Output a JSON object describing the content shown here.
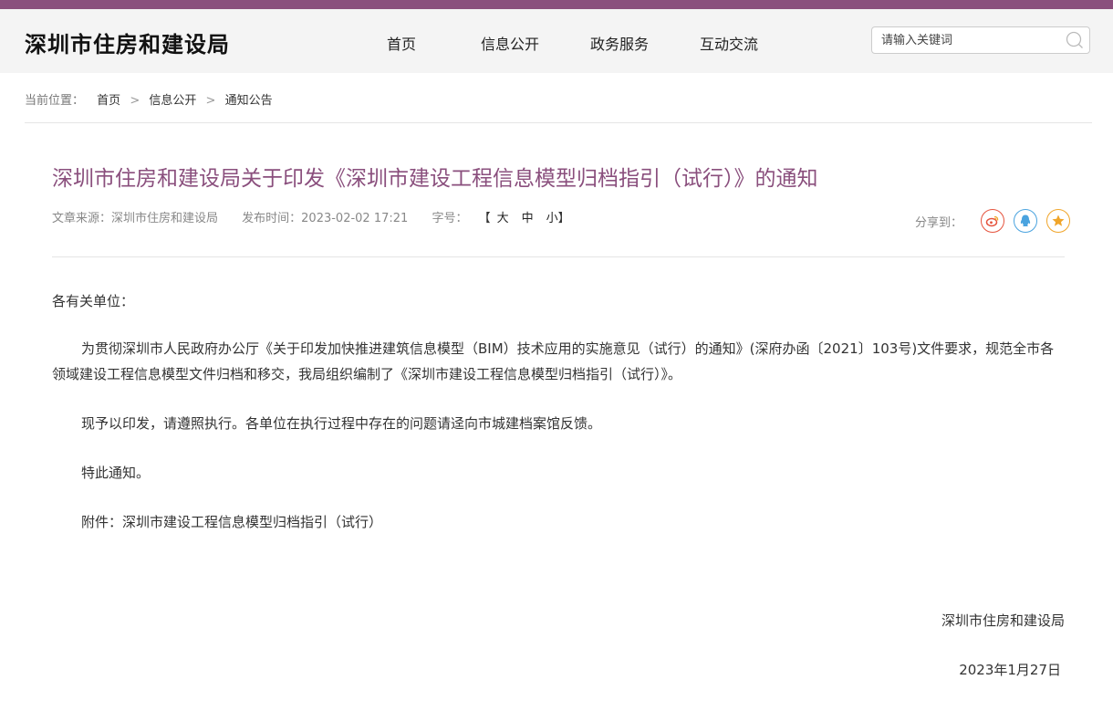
{
  "site": {
    "title": "深圳市住房和建设局"
  },
  "nav": {
    "items": [
      "首页",
      "信息公开",
      "政务服务",
      "互动交流"
    ]
  },
  "search": {
    "placeholder": "请输入关键词"
  },
  "breadcrumb": {
    "label": "当前位置：",
    "items": [
      "首页",
      "信息公开",
      "通知公告"
    ],
    "separator": ">"
  },
  "article": {
    "title": "深圳市住房和建设局关于印发《深圳市建设工程信息模型归档指引（试行）》的通知",
    "source": "文章来源：深圳市住房和建设局",
    "published": "发布时间：2023-02-02 17:21",
    "font_size_label": "字号：",
    "font_size_open": "【",
    "font_size_close": "】",
    "font_sizes": [
      "大",
      "中",
      "小"
    ],
    "share_label": "分享到：",
    "share_icons": [
      "weibo-icon",
      "qq-icon",
      "favorite-icon"
    ],
    "greeting": "各有关单位：",
    "paragraphs": [
      "为贯彻深圳市人民政府办公厅《关于印发加快推进建筑信息模型（BIM）技术应用的实施意见（试行）的通知》(深府办函〔2021〕103号)文件要求，规范全市各领域建设工程信息模型文件归档和移交，我局组织编制了《深圳市建设工程信息模型归档指引（试行）》。",
      "现予以印发，请遵照执行。各单位在执行过程中存在的问题请迳向市城建档案馆反馈。",
      "特此通知。",
      "附件：深圳市建设工程信息模型归档指引（试行）"
    ],
    "signature": "深圳市住房和建设局",
    "date": "2023年1月27日"
  },
  "colors": {
    "brand": "#8a4f7d",
    "weibo": "#e5533d",
    "qq": "#4aa3df",
    "favorite": "#f0a52a"
  }
}
